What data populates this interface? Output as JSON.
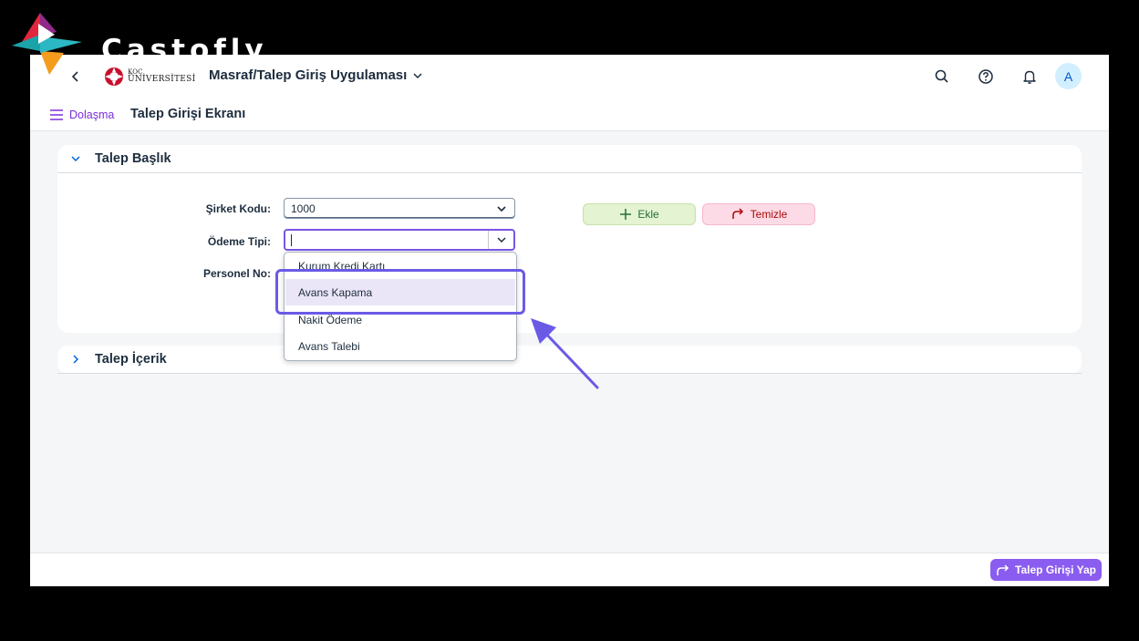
{
  "watermark": {
    "brand": "Castofly"
  },
  "shellbar": {
    "logo_line1": "KOÇ",
    "logo_line2": "ÜNİVERSİTESİ",
    "app_title": "Masraf/Talep Giriş Uygulaması",
    "avatar_initial": "A"
  },
  "subbar": {
    "nav_label": "Dolaşma",
    "page_title": "Talep Girişi Ekranı"
  },
  "header_panel": {
    "title": "Talep Başlık",
    "expanded": true,
    "fields": {
      "company_code_label": "Şirket Kodu:",
      "company_code_value": "1000",
      "payment_type_label": "Ödeme Tipi:",
      "payment_type_value": "",
      "personnel_no_label": "Personel No:"
    },
    "buttons": {
      "add_label": "Ekle",
      "clear_label": "Temizle"
    }
  },
  "payment_type_dropdown": {
    "open": true,
    "options": [
      "Kurum Kredi Kartı",
      "Avans Kapama",
      "Nakit Ödeme",
      "Avans Talebi"
    ],
    "highlighted_option": "Avans Kapama"
  },
  "content_panel": {
    "title": "Talep İçerik",
    "expanded": false
  },
  "footer": {
    "submit_label": "Talep Girişi Yap"
  },
  "colors": {
    "accent": "#7a55e6",
    "annotation": "#6a5ae6",
    "submit_bg": "#8b5cf0",
    "add_bg": "#e4f3d1",
    "clear_bg": "#fddbe6"
  }
}
